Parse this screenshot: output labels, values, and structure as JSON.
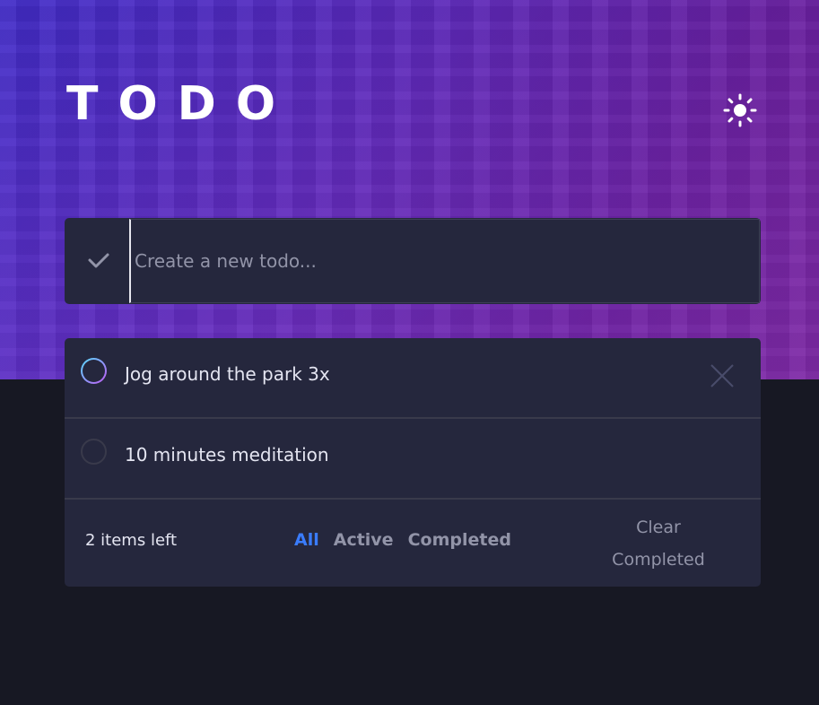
{
  "header": {
    "title": "TODO",
    "theme_icon": "sun-icon"
  },
  "create": {
    "check_icon": "check-icon",
    "placeholder": "Create a new todo..."
  },
  "todos": [
    {
      "text": "Jog around the park 3x",
      "checkbox_style": "gradient-ring",
      "delete_icon": "close-icon"
    },
    {
      "text": "10 minutes meditation",
      "checkbox_style": "plain-ring"
    }
  ],
  "footer": {
    "items_left": "2 items left",
    "filters": [
      "All",
      "Active",
      "Completed"
    ],
    "active_filter": "All",
    "clear_line1": "Clear",
    "clear_line2": "Completed"
  },
  "colors": {
    "accent_blue": "#3a7cfd",
    "panel": "#25273d",
    "background": "#171823",
    "gradient_start": "#57ddff",
    "gradient_end": "#c058f3"
  }
}
